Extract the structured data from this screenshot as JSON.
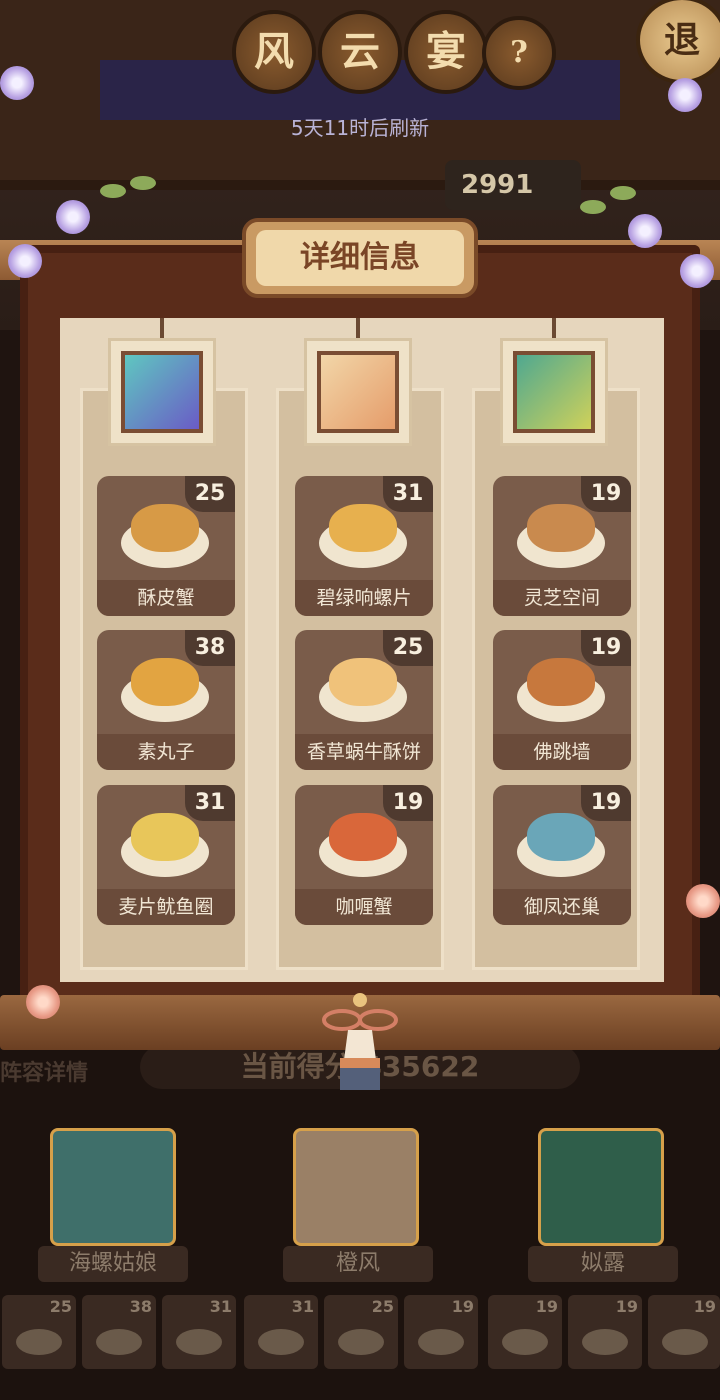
{
  "header": {
    "title_chars": [
      "风",
      "云",
      "宴"
    ],
    "help_label": "?",
    "back_label": "退",
    "refresh_text": "5天11时后刷新",
    "top_score": "2991"
  },
  "panel": {
    "title": "详细信息",
    "columns": [
      {
        "portrait_colors": [
          "#5fc7c0",
          "#6a5bc6"
        ],
        "dishes": [
          {
            "name": "酥皮蟹",
            "count": "25",
            "food_color": "#d79a46"
          },
          {
            "name": "素丸子",
            "count": "38",
            "food_color": "#e2a441"
          },
          {
            "name": "麦片鱿鱼圈",
            "count": "31",
            "food_color": "#e8c65a"
          }
        ]
      },
      {
        "portrait_colors": [
          "#f2d6a8",
          "#e59c6a"
        ],
        "dishes": [
          {
            "name": "碧绿响螺片",
            "count": "31",
            "food_color": "#e7b04e"
          },
          {
            "name": "香草蜗牛酥饼",
            "count": "25",
            "food_color": "#f0c27a"
          },
          {
            "name": "咖喱蟹",
            "count": "19",
            "food_color": "#d9673a"
          }
        ]
      },
      {
        "portrait_colors": [
          "#4fa890",
          "#cfd15a"
        ],
        "dishes": [
          {
            "name": "灵芝空间",
            "count": "19",
            "food_color": "#c98a4e"
          },
          {
            "name": "佛跳墙",
            "count": "19",
            "food_color": "#c7783d"
          },
          {
            "name": "御凤还巢",
            "count": "19",
            "food_color": "#6aa6b8"
          }
        ]
      }
    ]
  },
  "behind": {
    "lineup_label": "阵容详情",
    "score_text": "当前得分 435622",
    "characters": [
      {
        "name": "海螺姑娘",
        "color": "#4aa3a0"
      },
      {
        "name": "橙风",
        "color": "#e8c39a"
      },
      {
        "name": "姒露",
        "color": "#3f8f6e"
      }
    ],
    "dish_strip": [
      "25",
      "38",
      "31",
      "31",
      "25",
      "19",
      "19",
      "19",
      "19"
    ]
  }
}
